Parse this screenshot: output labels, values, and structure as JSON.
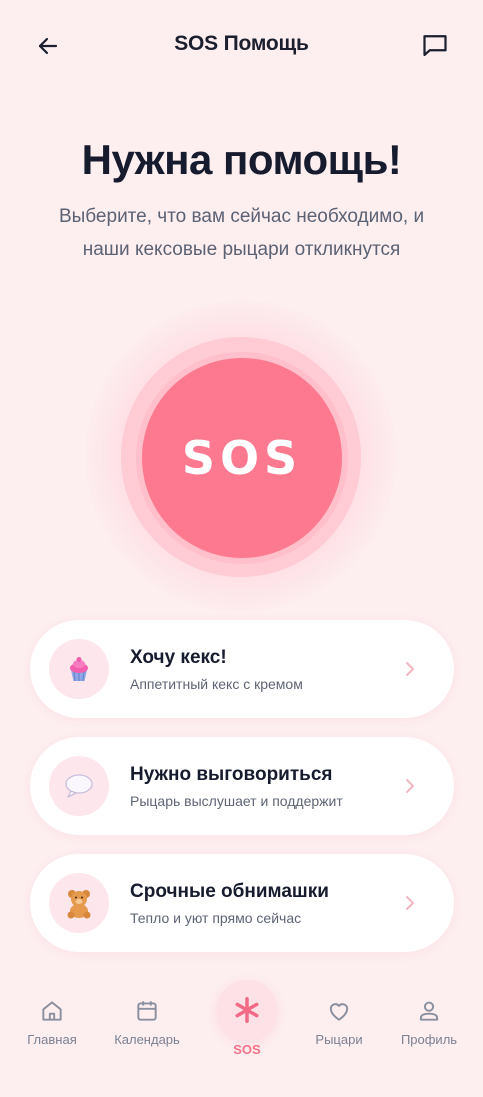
{
  "header": {
    "title": "SOS Помощь",
    "back_icon": "arrow-left-icon",
    "chat_icon": "message-square-icon"
  },
  "hero": {
    "title": "Нужна помощь!",
    "subtitle": "Выберите, что вам сейчас необходимо, и наши кексовые рыцари откликнутся"
  },
  "sos_button": {
    "label": "SOS",
    "color": "#fd7990"
  },
  "options": [
    {
      "title": "Хочу кекс!",
      "subtitle": "Аппетитный кекс с кремом",
      "icon": "cupcake-icon"
    },
    {
      "title": "Нужно выговориться",
      "subtitle": "Рыцарь выслушает и поддержит",
      "icon": "speech-bubble-icon"
    },
    {
      "title": "Срочные обнимашки",
      "subtitle": "Тепло и уют прямо сейчас",
      "icon": "teddy-bear-icon"
    }
  ],
  "nav": {
    "home": "Главная",
    "calendar": "Календарь",
    "sos": "SOS",
    "knights": "Рыцари",
    "profile": "Профиль",
    "active": "sos",
    "accent": "#f27289"
  }
}
